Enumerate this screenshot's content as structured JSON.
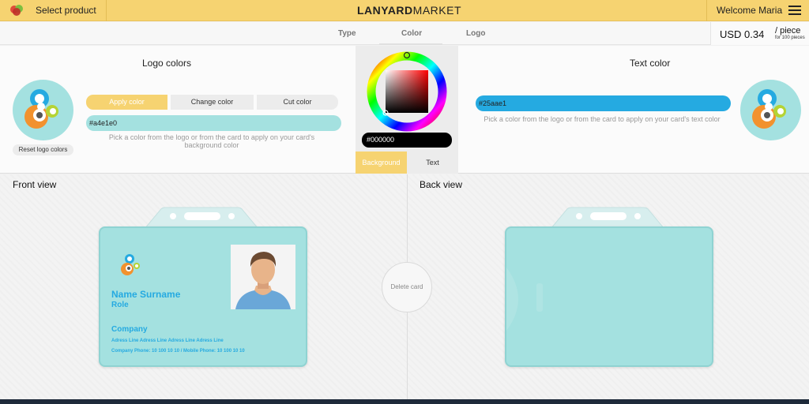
{
  "header": {
    "select_product": "Select product",
    "brand_bold": "LANYARD",
    "brand_light": "MARKET",
    "welcome": "Welcome Maria"
  },
  "tabs": {
    "type": "Type",
    "color": "Color",
    "logo": "Logo"
  },
  "price": {
    "amount": "USD 0.34",
    "unit": "/ piece",
    "unit_sub": "for 100 pieces"
  },
  "logo_colors": {
    "title": "Logo colors",
    "reset_label": "Reset logo colors",
    "apply_label": "Apply color",
    "change_label": "Change color",
    "cut_label": "Cut color",
    "value": "#a4e1e0",
    "hint": "Pick a color from the logo or from the card to apply on your card's background color"
  },
  "picker": {
    "hex_value": "#000000",
    "tab_background": "Background",
    "tab_text": "Text"
  },
  "text_color": {
    "title": "Text color",
    "value": "#25aae1",
    "hint": "Pick a color from the logo or from the card to apply on your card's text color"
  },
  "front_view": {
    "title": "Front view",
    "name": "Name Surname",
    "role": "Role",
    "company": "Company",
    "address": "Adress Line Adress Line Adress Line Adress Line",
    "phone": "Company Phone: 10 100 10 10 / Mobile Phone: 10 100 10 10"
  },
  "back_view": {
    "title": "Back view"
  },
  "delete_card": "Delete card",
  "colors": {
    "accent": "#f6d371",
    "card_bg": "#a4e1e0",
    "text_blue": "#25aae1"
  }
}
